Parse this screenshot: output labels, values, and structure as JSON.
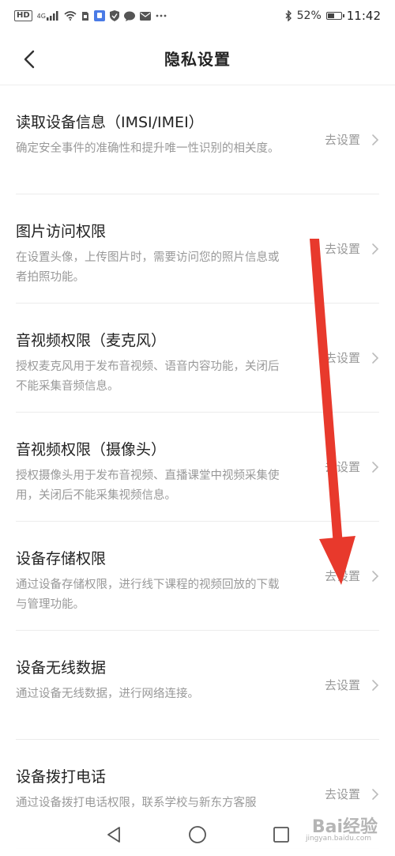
{
  "status_bar": {
    "network_hd": "HD",
    "network_type": "4G",
    "battery_percent": "52%",
    "battery_level": 0.52,
    "time": "11:42",
    "icons": [
      "signal-icon",
      "wifi-icon",
      "sim-icon",
      "app-notification-icon",
      "shield-icon",
      "chat-icon",
      "mail-icon",
      "more-dots-icon",
      "bluetooth-icon",
      "battery-icon"
    ]
  },
  "header": {
    "title": "隐私设置",
    "back_icon": "chevron-left-icon"
  },
  "settings": {
    "action_label": "去设置",
    "items": [
      {
        "title": "读取设备信息（IMSI/IMEI）",
        "desc": "确定安全事件的准确性和提升唯一性识别的相关度。"
      },
      {
        "title": "图片访问权限",
        "desc": "在设置头像，上传图片时，需要访问您的照片信息或者拍照功能。"
      },
      {
        "title": "音视频权限（麦克风）",
        "desc": "授权麦克风用于发布音视频、语音内容功能，关闭后不能采集音频信息。"
      },
      {
        "title": "音视频权限（摄像头）",
        "desc": "授权摄像头用于发布音视频、直播课堂中视频采集使用，关闭后不能采集视频信息。"
      },
      {
        "title": "设备存储权限",
        "desc": "通过设备存储权限，进行线下课程的视频回放的下载与管理功能。"
      },
      {
        "title": "设备无线数据",
        "desc": "通过设备无线数据，进行网络连接。"
      },
      {
        "title": "设备拨打电话",
        "desc": "通过设备拨打电话权限，联系学校与新东方客服"
      }
    ]
  },
  "nav_bar": {
    "icons": [
      "nav-back-icon",
      "nav-home-icon",
      "nav-recent-icon"
    ]
  },
  "overlay": {
    "arrow_color": "#e8392c",
    "watermark": "Bai经验",
    "watermark_sub": "jingyan.baidu.com"
  },
  "colors": {
    "title_text": "#222222",
    "secondary_text": "#999999",
    "divider": "#ececec",
    "background": "#ffffff"
  }
}
